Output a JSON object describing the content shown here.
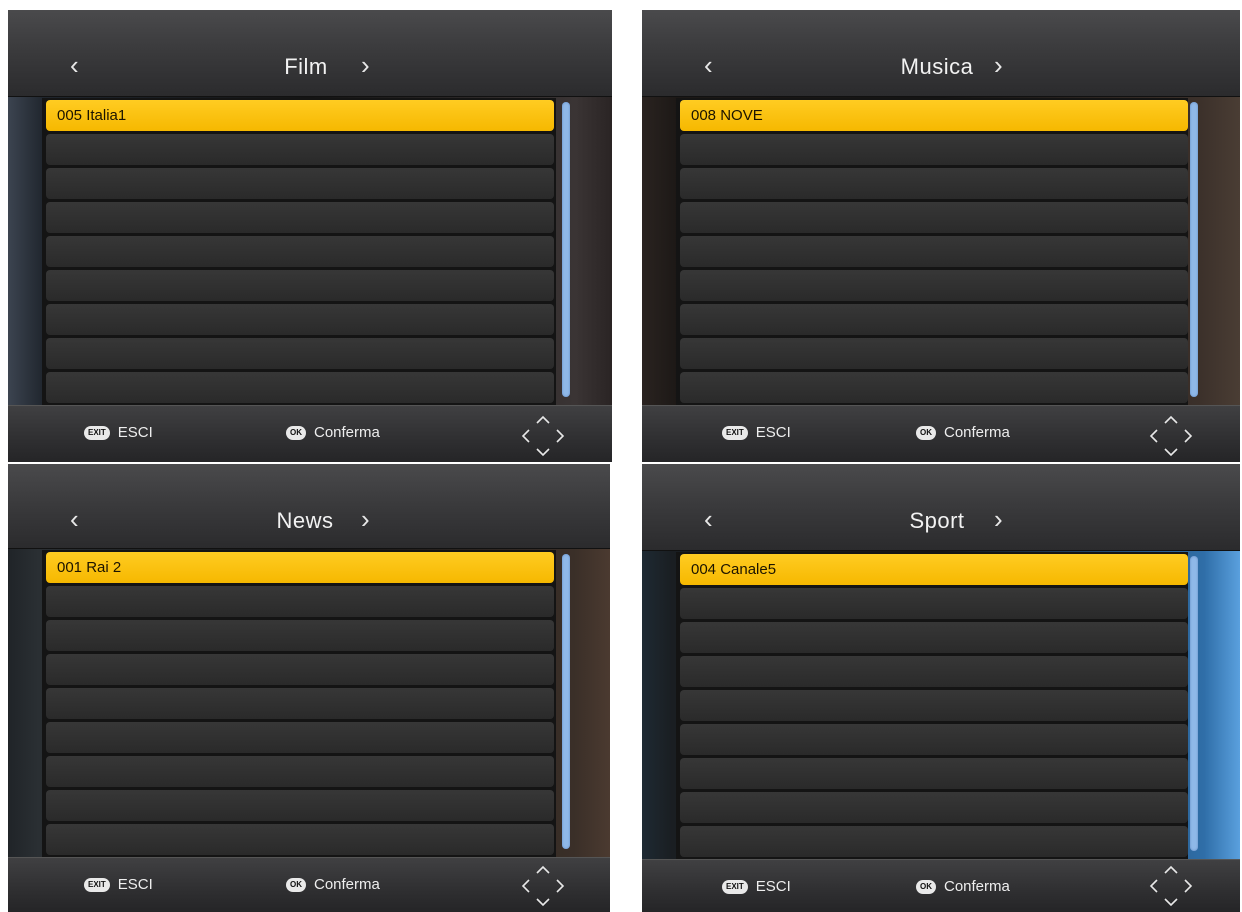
{
  "panels": [
    {
      "title": "Film",
      "selected": "005 Italia1",
      "rows": 9
    },
    {
      "title": "Musica",
      "selected": "008 NOVE",
      "rows": 9
    },
    {
      "title": "News",
      "selected": "001 Rai 2",
      "rows": 9
    },
    {
      "title": "Sport",
      "selected": "004 Canale5",
      "rows": 9
    }
  ],
  "footer": {
    "exit_badge": "EXIT",
    "exit_label": "ESCI",
    "ok_badge": "OK",
    "ok_label": "Conferma"
  },
  "icons": {
    "prev": "chevron-left-icon",
    "next": "chevron-right-icon",
    "navigation": "dpad-arrows-icon"
  },
  "colors": {
    "selected_row": "#f6b800",
    "scrollbar": "#8fb8e8"
  }
}
